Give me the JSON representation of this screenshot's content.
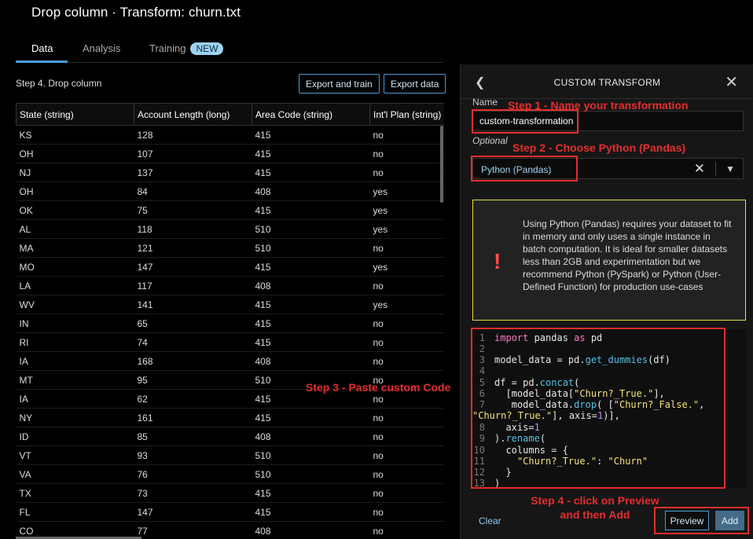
{
  "page": {
    "title": "Drop column · Transform: churn.txt"
  },
  "tabs": [
    {
      "label": "Data"
    },
    {
      "label": "Analysis"
    },
    {
      "label": "Training",
      "badge": "NEW"
    }
  ],
  "left": {
    "step_label": "Step 4. Drop column",
    "export_train_label": "Export and train",
    "export_data_label": "Export data"
  },
  "table": {
    "columns": [
      "State (string)",
      "Account Length (long)",
      "Area Code (string)",
      "Int'l Plan (string)"
    ],
    "rows": [
      [
        "KS",
        "128",
        "415",
        "no"
      ],
      [
        "OH",
        "107",
        "415",
        "no"
      ],
      [
        "NJ",
        "137",
        "415",
        "no"
      ],
      [
        "OH",
        "84",
        "408",
        "yes"
      ],
      [
        "OK",
        "75",
        "415",
        "yes"
      ],
      [
        "AL",
        "118",
        "510",
        "yes"
      ],
      [
        "MA",
        "121",
        "510",
        "no"
      ],
      [
        "MO",
        "147",
        "415",
        "yes"
      ],
      [
        "LA",
        "117",
        "408",
        "no"
      ],
      [
        "WV",
        "141",
        "415",
        "yes"
      ],
      [
        "IN",
        "65",
        "415",
        "no"
      ],
      [
        "RI",
        "74",
        "415",
        "no"
      ],
      [
        "IA",
        "168",
        "408",
        "no"
      ],
      [
        "MT",
        "95",
        "510",
        "no"
      ],
      [
        "IA",
        "62",
        "415",
        "no"
      ],
      [
        "NY",
        "161",
        "415",
        "no"
      ],
      [
        "ID",
        "85",
        "408",
        "no"
      ],
      [
        "VT",
        "93",
        "510",
        "no"
      ],
      [
        "VA",
        "76",
        "510",
        "no"
      ],
      [
        "TX",
        "73",
        "415",
        "no"
      ],
      [
        "FL",
        "147",
        "415",
        "no"
      ],
      [
        "CO",
        "77",
        "408",
        "no"
      ]
    ]
  },
  "panel": {
    "title": "CUSTOM TRANSFORM",
    "name_label": "Name",
    "name_value": "custom-transformation",
    "optional_label": "Optional",
    "language_value": "Python (Pandas)",
    "warning_text": "Using Python (Pandas) requires your dataset to fit in memory and only uses a single instance in batch computation. It is ideal for smaller datasets less than 2GB and experimentation but we recommend Python (PySpark) or Python (User-Defined Function) for production use-cases",
    "clear_label": "Clear",
    "preview_label": "Preview",
    "add_label": "Add"
  },
  "code": {
    "line_numbers": [
      "1",
      "2",
      "3",
      "4",
      "5",
      "6",
      "7",
      "",
      "8",
      "9",
      "10",
      "11",
      "12",
      "13"
    ]
  },
  "annotations": {
    "step1": "Step 1 - Name your transformation",
    "step2": "Step 2 - Choose Python (Pandas)",
    "step3": "Step 3 - Paste custom Code",
    "step4_line1": "Step 4 - click on Preview",
    "step4_line2": "and then Add"
  },
  "colors": {
    "accent": "#4a9bd6",
    "annotation_red": "#e62d2d",
    "warning_border": "#e7df3e",
    "add_button": "#446b88"
  },
  "icons": {
    "back": "chevron-left-icon",
    "close": "close-icon",
    "clear_select": "x-icon",
    "dropdown": "caret-down-icon",
    "warning": "exclamation-icon"
  }
}
